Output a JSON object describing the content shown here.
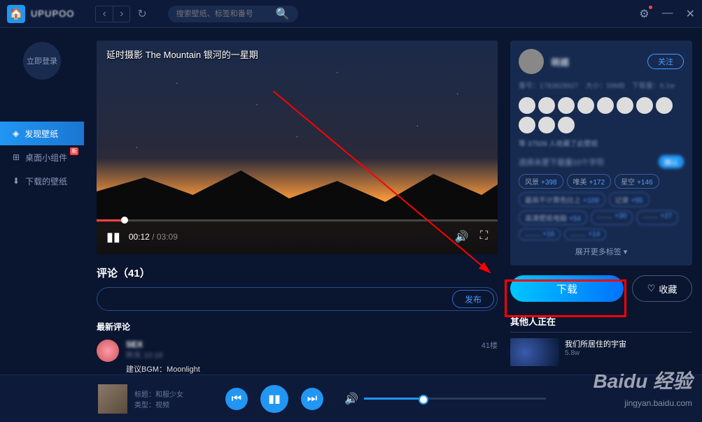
{
  "brand": "UPUPOO",
  "search": {
    "placeholder": "搜索壁纸、标签和番号"
  },
  "login_label": "立即登录",
  "sidebar": {
    "items": [
      {
        "label": "发现壁纸",
        "icon": "discover-icon"
      },
      {
        "label": "桌面小组件",
        "icon": "widget-icon",
        "badge": "新"
      },
      {
        "label": "下载的壁纸",
        "icon": "download-icon"
      }
    ]
  },
  "video": {
    "title": "延时摄影 The Mountain 银河的一星期",
    "current": "00:12",
    "duration": "03:09"
  },
  "comments": {
    "header_prefix": "评论（",
    "count": "41",
    "header_suffix": "）",
    "publish": "发布",
    "latest_label": "最新评论",
    "first": {
      "name": "SEX",
      "time": "昨天 10:16",
      "text": "建议BGM：Moonlight",
      "floor": "41楼"
    }
  },
  "author": {
    "name": "萌媚",
    "follow": "关注",
    "meta": {
      "id_label": "番号：",
      "id": "1783828927",
      "size_label": "大小：",
      "size": "59MB",
      "dl_label": "下载量：",
      "downloads": "6.1w"
    },
    "fans_text": "等 37509 人收藏了此壁纸",
    "tag_hint": "选择未更下载量10个字符",
    "tag_confirm": "确认",
    "tags": [
      {
        "t": "风景",
        "n": "+398"
      },
      {
        "t": "唯美",
        "n": "+172"
      },
      {
        "t": "星空",
        "n": "+146"
      },
      {
        "t": "最高不计算色比上",
        "n": "+109"
      },
      {
        "t": "记录",
        "n": "+55"
      },
      {
        "t": "高清壁纸电脑",
        "n": "+54"
      },
      {
        "t": "........",
        "n": "+30"
      },
      {
        "t": "........",
        "n": "+27"
      },
      {
        "t": "........",
        "n": "+16"
      },
      {
        "t": "........",
        "n": "+14"
      }
    ],
    "expand": "展开更多标签 ▾"
  },
  "actions": {
    "download": "下载",
    "favorite": "收藏"
  },
  "others": {
    "header": "其他人正在",
    "item1": {
      "title": "我们所居住的宇宙",
      "views": "5.8w"
    }
  },
  "player": {
    "title_label": "标题：",
    "title": "和服少女",
    "type_label": "类型：",
    "type": "视频"
  },
  "watermark": {
    "main": "Baidu 经验",
    "sub": "jingyan.baidu.com"
  }
}
